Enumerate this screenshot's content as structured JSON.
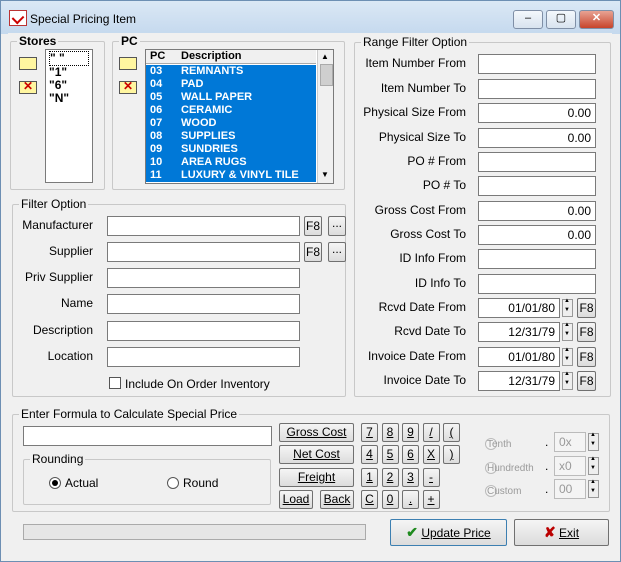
{
  "window": {
    "title": "Special Pricing Item",
    "minimize": "‒",
    "maximize": "▢",
    "close": "✕"
  },
  "stores": {
    "legend": "Stores",
    "items": [
      "\" \"",
      "\"1\"",
      "\"6\"",
      "\"N\""
    ]
  },
  "pc": {
    "legend": "PC",
    "headers": [
      "PC",
      "Description"
    ],
    "rows": [
      [
        "03",
        "REMNANTS"
      ],
      [
        "04",
        "PAD"
      ],
      [
        "05",
        "WALL PAPER"
      ],
      [
        "06",
        "CERAMIC"
      ],
      [
        "07",
        "WOOD"
      ],
      [
        "08",
        "SUPPLIES"
      ],
      [
        "09",
        "SUNDRIES"
      ],
      [
        "10",
        "AREA RUGS"
      ],
      [
        "11",
        "LUXURY & VINYL TILE"
      ]
    ]
  },
  "filter": {
    "legend": "Filter Option",
    "manufacturer": "Manufacturer",
    "supplier": "Supplier",
    "priv_supplier": "Priv Supplier",
    "name": "Name",
    "description": "Description",
    "location": "Location",
    "f8": "F8",
    "ellipsis": "...",
    "include_on_order": "Include On Order Inventory"
  },
  "range": {
    "legend": "Range Filter Option",
    "item_from": "Item Number From",
    "item_to": "Item Number To",
    "phys_from": "Physical Size From",
    "phys_from_val": "0.00",
    "phys_to": "Physical Size To",
    "phys_to_val": "0.00",
    "po_from": "PO # From",
    "po_to": "PO # To",
    "gc_from": "Gross Cost From",
    "gc_from_val": "0.00",
    "gc_to": "Gross Cost To",
    "gc_to_val": "0.00",
    "id_from": "ID Info From",
    "id_to": "ID Info To",
    "rcvd_from": "Rcvd Date From",
    "rcvd_from_val": "01/01/80",
    "rcvd_to": "Rcvd Date To",
    "rcvd_to_val": "12/31/79",
    "inv_from": "Invoice Date From",
    "inv_from_val": "01/01/80",
    "inv_to": "Invoice Date To",
    "inv_to_val": "12/31/79",
    "f8": "F8"
  },
  "formula": {
    "legend": "Enter Formula to Calculate Special Price",
    "gross_cost": "Gross Cost",
    "net_cost": "Net Cost",
    "freight": "Freight",
    "load": "Load",
    "back": "Back",
    "keys_row1": [
      "7",
      "8",
      "9",
      "/",
      "("
    ],
    "keys_row2": [
      "4",
      "5",
      "6",
      "X",
      ")"
    ],
    "keys_row3": [
      "1",
      "2",
      "3",
      "-"
    ],
    "keys_row4": [
      "C",
      "0",
      ".",
      "+"
    ],
    "rounding_legend": "Rounding",
    "actual": "Actual",
    "round": "Round",
    "tenth": "Tenth",
    "hundredth": "Hundredth",
    "custom": "Custom",
    "tenth_val": "0x",
    "hundredth_val": "x0",
    "custom_val": "00",
    "dot": "."
  },
  "footer": {
    "update_price": "Update Price",
    "exit": "Exit"
  }
}
